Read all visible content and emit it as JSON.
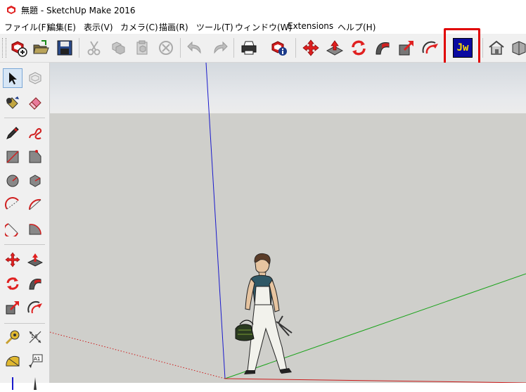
{
  "window": {
    "title": "無題 - SketchUp Make 2016"
  },
  "menu": [
    "ファイル(F)",
    "編集(E)",
    "表示(V)",
    "カメラ(C)",
    "描画(R)",
    "ツール(T)",
    "ウィンドウ(W)",
    "Extensions",
    "ヘルプ(H)"
  ],
  "toolbar": {
    "jw_label": "Jw",
    "buttons": [
      "new-icon",
      "open-icon",
      "save-icon",
      "cut-icon",
      "copy-icon",
      "paste-icon",
      "erase-icon",
      "undo-icon",
      "redo-icon",
      "print-icon",
      "model-info-icon",
      "move-icon",
      "push-pull-icon",
      "rotate-icon",
      "follow-me-icon",
      "scale-icon",
      "offset-icon",
      "jw-cad-icon",
      "house-icon",
      "box-icon"
    ]
  },
  "lefttools": {
    "text_label": "A1"
  },
  "colors": {
    "highlight": "#e00000",
    "jw_bg": "#0a0aa0",
    "jw_fg": "#ffe000",
    "axis_blue": "#1a1acc",
    "axis_green": "#1aa31a",
    "axis_red": "#cc1a1a"
  }
}
